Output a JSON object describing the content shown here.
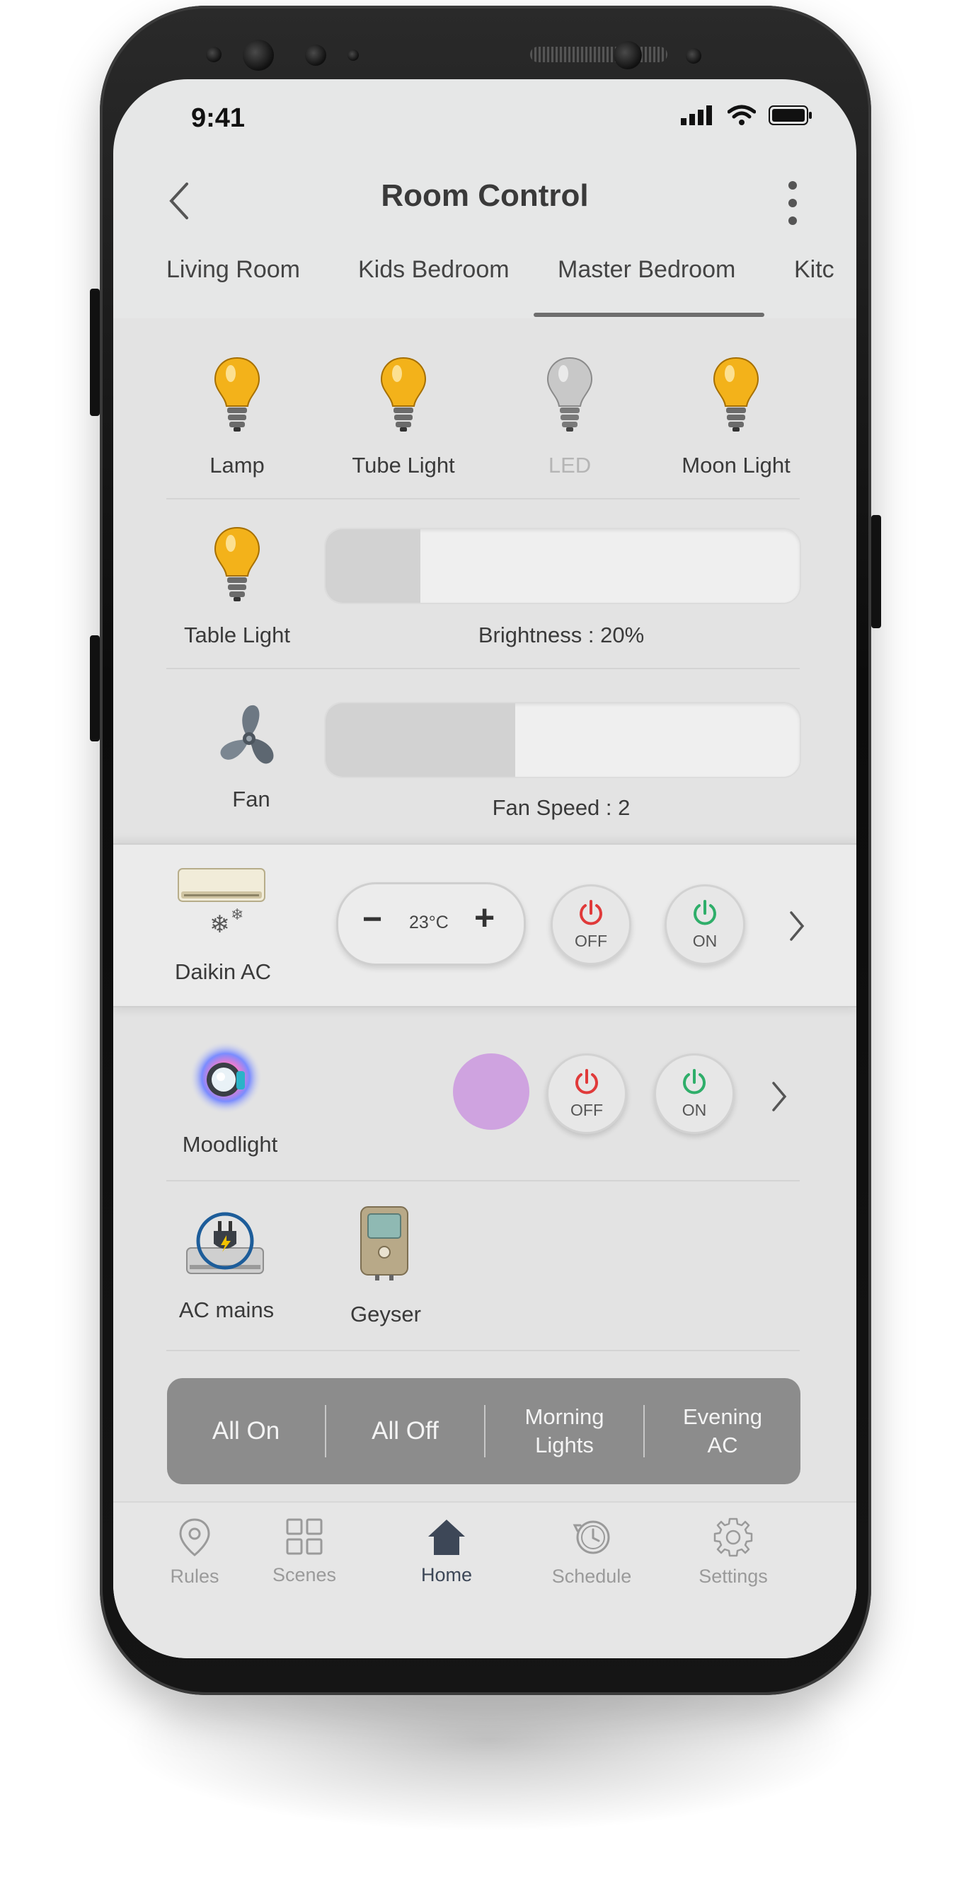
{
  "status_bar": {
    "time": "9:41"
  },
  "header": {
    "title": "Room Control"
  },
  "tabs": [
    {
      "label": "Living Room"
    },
    {
      "label": "Kids Bedroom"
    },
    {
      "label": "Master Bedroom",
      "active": true
    },
    {
      "label": "Kitc"
    }
  ],
  "devices": {
    "lamp": {
      "label": "Lamp",
      "state": "on"
    },
    "tube_light": {
      "label": "Tube Light",
      "state": "on"
    },
    "led": {
      "label": "LED",
      "state": "off"
    },
    "moon_light": {
      "label": "Moon Light",
      "state": "on"
    },
    "table_light": {
      "label": "Table Light",
      "brightness_label": "Brightness : 20%",
      "brightness": 0.2
    },
    "fan": {
      "label": "Fan",
      "speed_label": "Fan Speed : 2",
      "speed_fraction": 0.4
    },
    "ac": {
      "label": "Daikin AC",
      "temp": "23°C",
      "minus": "−",
      "plus": "+",
      "off_label": "OFF",
      "on_label": "ON"
    },
    "moodlight": {
      "label": "Moodlight",
      "color": "#cfa3e0",
      "off_label": "OFF",
      "on_label": "ON"
    },
    "ac_mains": {
      "label": "AC mains"
    },
    "geyser": {
      "label": "Geyser"
    }
  },
  "quick_actions": [
    {
      "label": "All On"
    },
    {
      "label": "All Off"
    },
    {
      "label": "Morning\nLights"
    },
    {
      "label": "Evening\nAC"
    }
  ],
  "bottom_nav": [
    {
      "label": "Rules",
      "icon": "location-pin-icon"
    },
    {
      "label": "Scenes",
      "icon": "grid-icon"
    },
    {
      "label": "Home",
      "icon": "home-icon",
      "active": true
    },
    {
      "label": "Schedule",
      "icon": "clock-icon"
    },
    {
      "label": "Settings",
      "icon": "gear-icon"
    }
  ],
  "colors": {
    "bulb_on": "#f3b21a",
    "bulb_off": "#c8c8c8",
    "power_off": "#e03a3a",
    "power_on": "#2fae6a",
    "nav_active": "#3d4757"
  }
}
